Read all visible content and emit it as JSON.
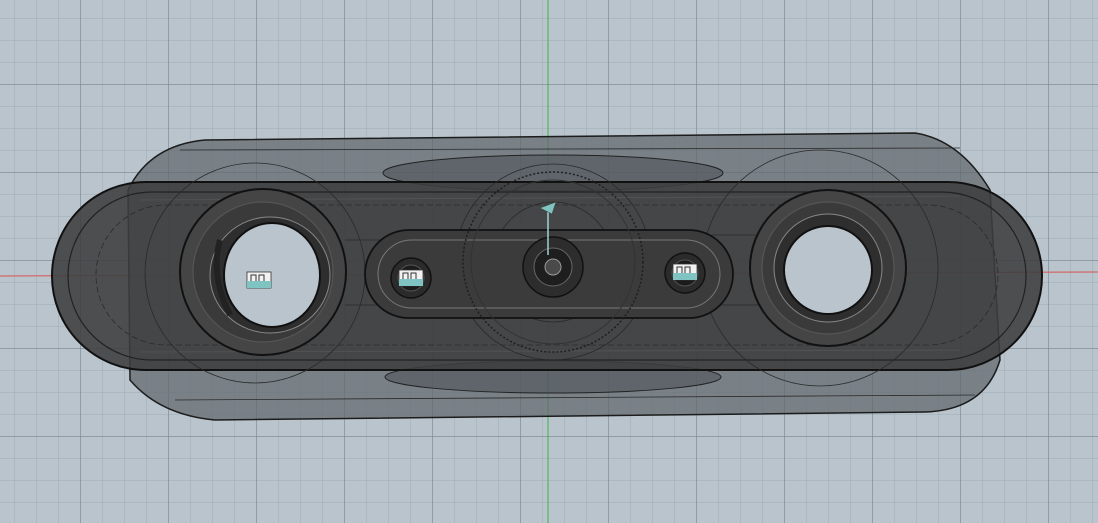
{
  "app": {
    "view_mode": "shaded-with-visible-edges",
    "colors": {
      "background": "#b9c4cc",
      "grid_major": "#7f8b96",
      "grid_minor": "#a3adb6",
      "axis_x": "#d9534f",
      "axis_y": "#3bb54a",
      "body_dark": "#3e3e3f",
      "body_translucent": "#6b7075",
      "edge": "#1c1c1c",
      "marker": "#7fc4c2"
    }
  },
  "viewport": {
    "axes": {
      "x_axis": "x-axis",
      "y_axis": "y-axis"
    },
    "model": {
      "name": "",
      "features": [
        "outer-housing",
        "front-bezel",
        "left-lens-ring",
        "right-lens-ring",
        "center-slot",
        "center-gear",
        "center-camera",
        "left-sensor-marker",
        "center-left-sensor-marker",
        "center-right-sensor-marker",
        "origin-triad-marker"
      ]
    }
  }
}
